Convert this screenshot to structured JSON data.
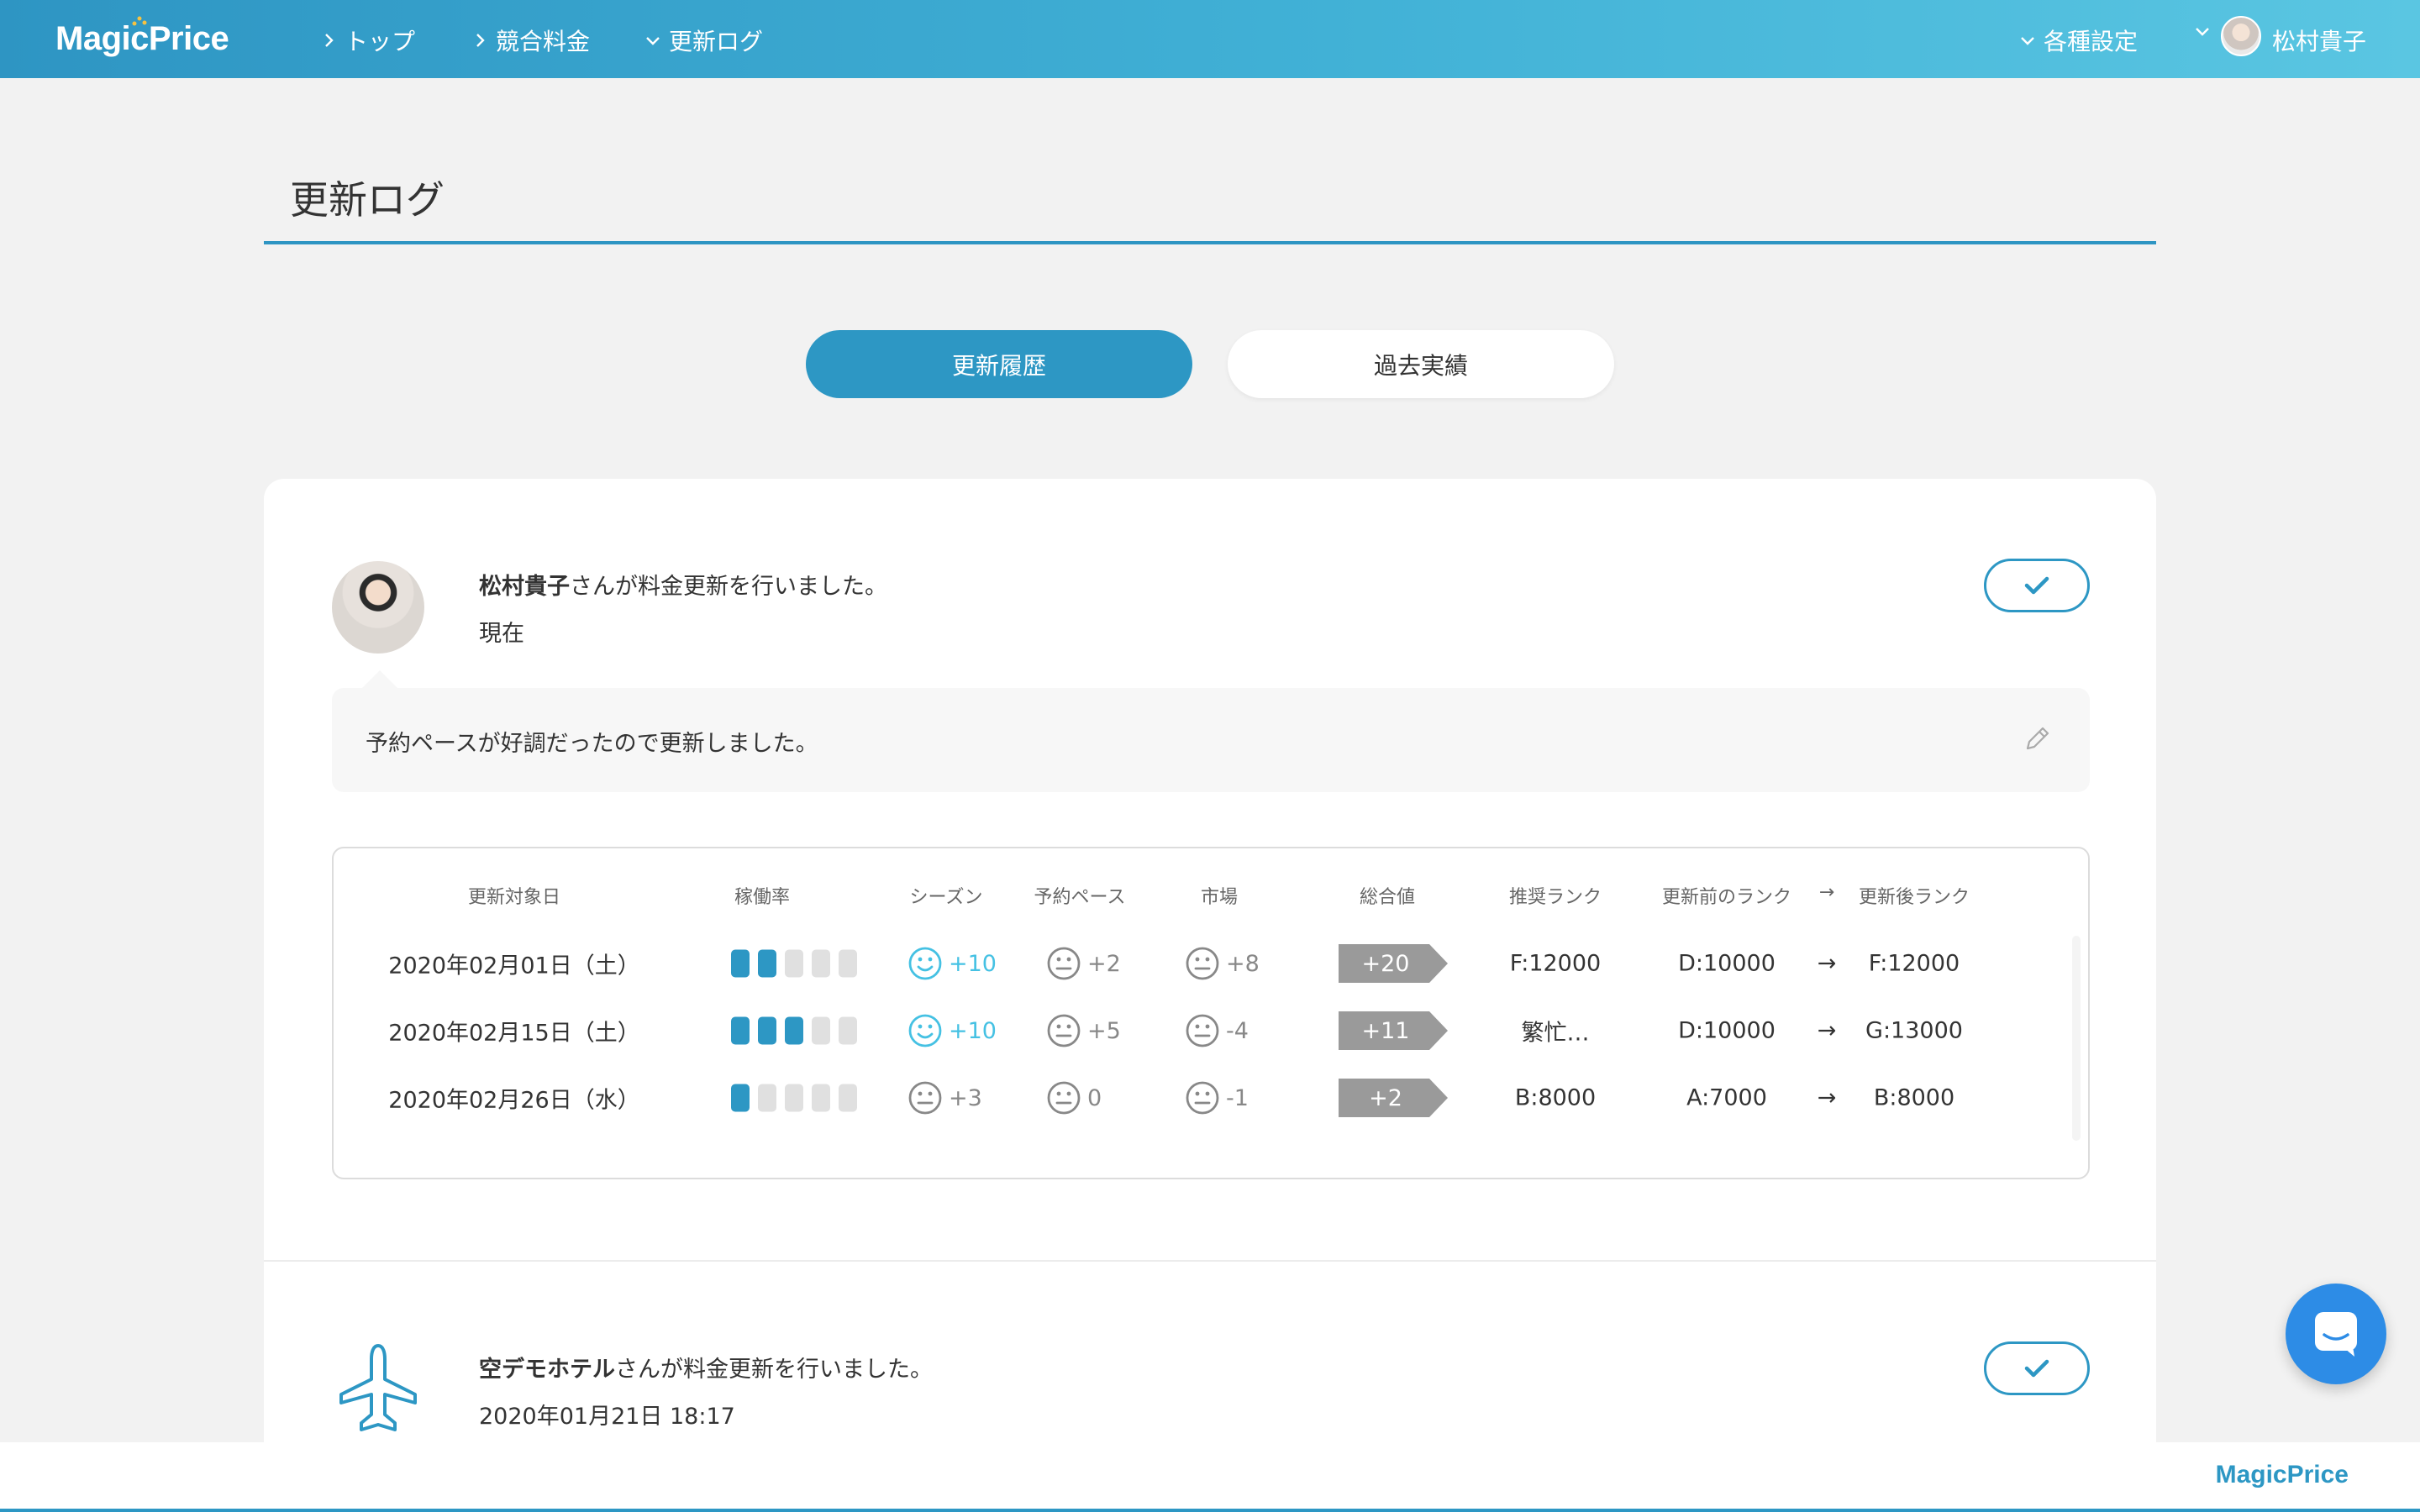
{
  "header": {
    "logo": "MagicPrice",
    "nav": [
      "トップ",
      "競合料金",
      "更新ログ"
    ],
    "settings": "各種設定",
    "user": "松村貴子"
  },
  "page": {
    "title": "更新ログ"
  },
  "tabs": {
    "active": "更新履歴",
    "other": "過去実績"
  },
  "entries": [
    {
      "user": "松村貴子",
      "action": "さんが料金更新を行いました。",
      "time": "現在",
      "memo": "予約ペースが好調だったので更新しました。"
    },
    {
      "user": "空デモホテル",
      "action": "さんが料金更新を行いました。",
      "time": "2020年01月21日 18:17"
    }
  ],
  "table": {
    "headers": [
      "更新対象日",
      "稼働率",
      "シーズン",
      "予約ペース",
      "市場",
      "総合値",
      "推奨ランク",
      "更新前のランク",
      "→",
      "更新後ランク"
    ],
    "rows": [
      {
        "date": "2020年02月01日（土）",
        "occupancy_level": 2,
        "season": "+10",
        "season_mood": "happy",
        "pace": "+2",
        "market": "+8",
        "total": "+20",
        "recommended": "F:12000",
        "before": "D:10000",
        "arrow": "→",
        "after": "F:12000"
      },
      {
        "date": "2020年02月15日（土）",
        "occupancy_level": 3,
        "season": "+10",
        "season_mood": "happy",
        "pace": "+5",
        "market": "-4",
        "total": "+11",
        "recommended": "繁忙…",
        "before": "D:10000",
        "arrow": "→",
        "after": "G:13000"
      },
      {
        "date": "2020年02月26日（水）",
        "occupancy_level": 1,
        "season": "+3",
        "season_mood": "neutral",
        "pace": "0",
        "market": "-1",
        "total": "+2",
        "recommended": "B:8000",
        "before": "A:7000",
        "arrow": "→",
        "after": "B:8000"
      }
    ],
    "occupancy_max": 5
  },
  "footer": {
    "logo": "MagicPrice"
  },
  "colors": {
    "brand": "#2d97c4",
    "positive": "#45c1e3",
    "neutral": "#888888",
    "tag": "#9a9a9a"
  }
}
